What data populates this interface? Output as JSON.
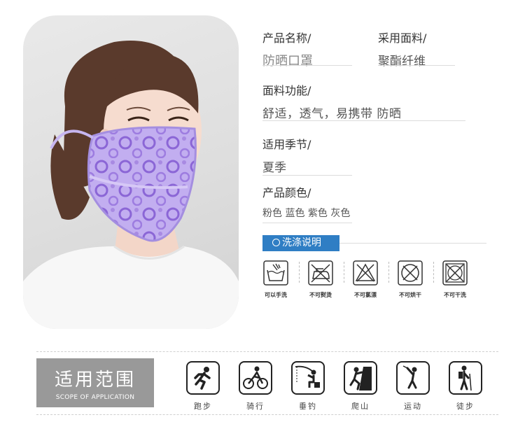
{
  "specs": {
    "name": {
      "label": "产品名称/",
      "value": "防晒口罩"
    },
    "fabric": {
      "label": "采用面料/",
      "value": "聚酯纤维"
    },
    "function": {
      "label": "面料功能/",
      "value": "舒适，透气，易携带  防晒"
    },
    "season": {
      "label": "适用季节/",
      "value": "夏季"
    },
    "colors": {
      "label": "产品颜色/",
      "value": "粉色 蓝色 紫色 灰色"
    }
  },
  "washing": {
    "title": "洗涤说明",
    "items": [
      {
        "label": "可以手洗",
        "icon": "hand-wash-icon"
      },
      {
        "label": "不可熨烫",
        "icon": "no-iron-icon"
      },
      {
        "label": "不可氯漂",
        "icon": "no-bleach-icon"
      },
      {
        "label": "不可烘干",
        "icon": "no-tumble-dry-icon"
      },
      {
        "label": "不可干洗",
        "icon": "no-dry-clean-icon"
      }
    ]
  },
  "scope": {
    "title": "适用范围",
    "subtitle": "SCOPE OF APPLICATION",
    "activities": [
      {
        "label": "跑步",
        "icon": "running-icon"
      },
      {
        "label": "骑行",
        "icon": "cycling-icon"
      },
      {
        "label": "垂钓",
        "icon": "fishing-icon"
      },
      {
        "label": "爬山",
        "icon": "climbing-icon"
      },
      {
        "label": "运动",
        "icon": "golf-icon"
      },
      {
        "label": "徒步",
        "icon": "hiking-icon"
      }
    ]
  },
  "colors": {
    "accent": "#2f7ec4",
    "scope_box": "#999999",
    "mask_purple": "#b29ae8"
  }
}
